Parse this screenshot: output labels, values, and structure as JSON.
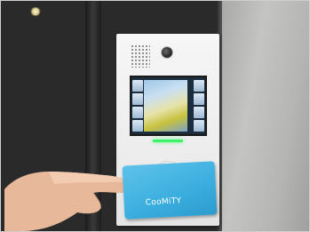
{
  "photo": {
    "subject": "door-entry-intercom-with-rfid-card",
    "colors": {
      "panel": "#efefef",
      "wall": "#b8b8b6",
      "card": "#3aaedf",
      "led": "#3ff06a",
      "door": "#2a2a2a"
    }
  },
  "intercom": {
    "icons": [
      "speaker-grille-icon",
      "camera-lens-icon",
      "card-reader-icon"
    ]
  },
  "card": {
    "brand_text": "CooMiTY"
  }
}
